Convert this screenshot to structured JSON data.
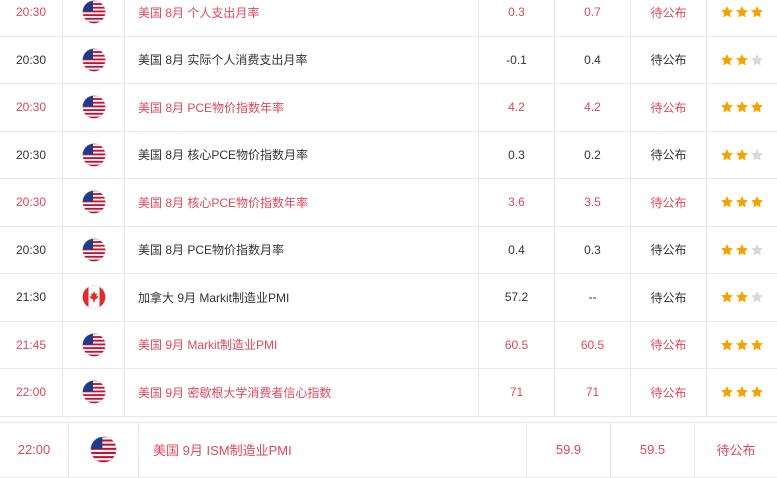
{
  "colors": {
    "highlight": "#e0475a",
    "normal": "#333333",
    "star_on": "#f4a400",
    "star_off": "#d9d9d9",
    "border": "#e9e9e9"
  },
  "rows": [
    {
      "time": "20:30",
      "country_icon": "us-flag-icon",
      "event": "美国 8月 个人支出月率",
      "previous": "0.3",
      "forecast": "0.7",
      "actual": "待公布",
      "importance": 3,
      "highlight": true
    },
    {
      "time": "20:30",
      "country_icon": "us-flag-icon",
      "event": "美国 8月 实际个人消费支出月率",
      "previous": "-0.1",
      "forecast": "0.4",
      "actual": "待公布",
      "importance": 2,
      "highlight": false
    },
    {
      "time": "20:30",
      "country_icon": "us-flag-icon",
      "event": "美国 8月 PCE物价指数年率",
      "previous": "4.2",
      "forecast": "4.2",
      "actual": "待公布",
      "importance": 3,
      "highlight": true
    },
    {
      "time": "20:30",
      "country_icon": "us-flag-icon",
      "event": "美国 8月 核心PCE物价指数月率",
      "previous": "0.3",
      "forecast": "0.2",
      "actual": "待公布",
      "importance": 2,
      "highlight": false
    },
    {
      "time": "20:30",
      "country_icon": "us-flag-icon",
      "event": "美国 8月 核心PCE物价指数年率",
      "previous": "3.6",
      "forecast": "3.5",
      "actual": "待公布",
      "importance": 3,
      "highlight": true
    },
    {
      "time": "20:30",
      "country_icon": "us-flag-icon",
      "event": "美国 8月 PCE物价指数月率",
      "previous": "0.4",
      "forecast": "0.3",
      "actual": "待公布",
      "importance": 2,
      "highlight": false
    },
    {
      "time": "21:30",
      "country_icon": "canada-flag-icon",
      "event": "加拿大 9月 Markit制造业PMI",
      "previous": "57.2",
      "forecast": "--",
      "actual": "待公布",
      "importance": 2,
      "highlight": false
    },
    {
      "time": "21:45",
      "country_icon": "us-flag-icon",
      "event": "美国 9月 Markit制造业PMI",
      "previous": "60.5",
      "forecast": "60.5",
      "actual": "待公布",
      "importance": 3,
      "highlight": true
    },
    {
      "time": "22:00",
      "country_icon": "us-flag-icon",
      "event": "美国 9月 密歇根大学消费者信心指数",
      "previous": "71",
      "forecast": "71",
      "actual": "待公布",
      "importance": 3,
      "highlight": true
    }
  ],
  "last_row": {
    "time": "22:00",
    "country_icon": "us-flag-icon",
    "event": "美国 9月 ISM制造业PMI",
    "previous": "59.9",
    "forecast": "59.5",
    "actual": "待公布",
    "highlight": true
  }
}
